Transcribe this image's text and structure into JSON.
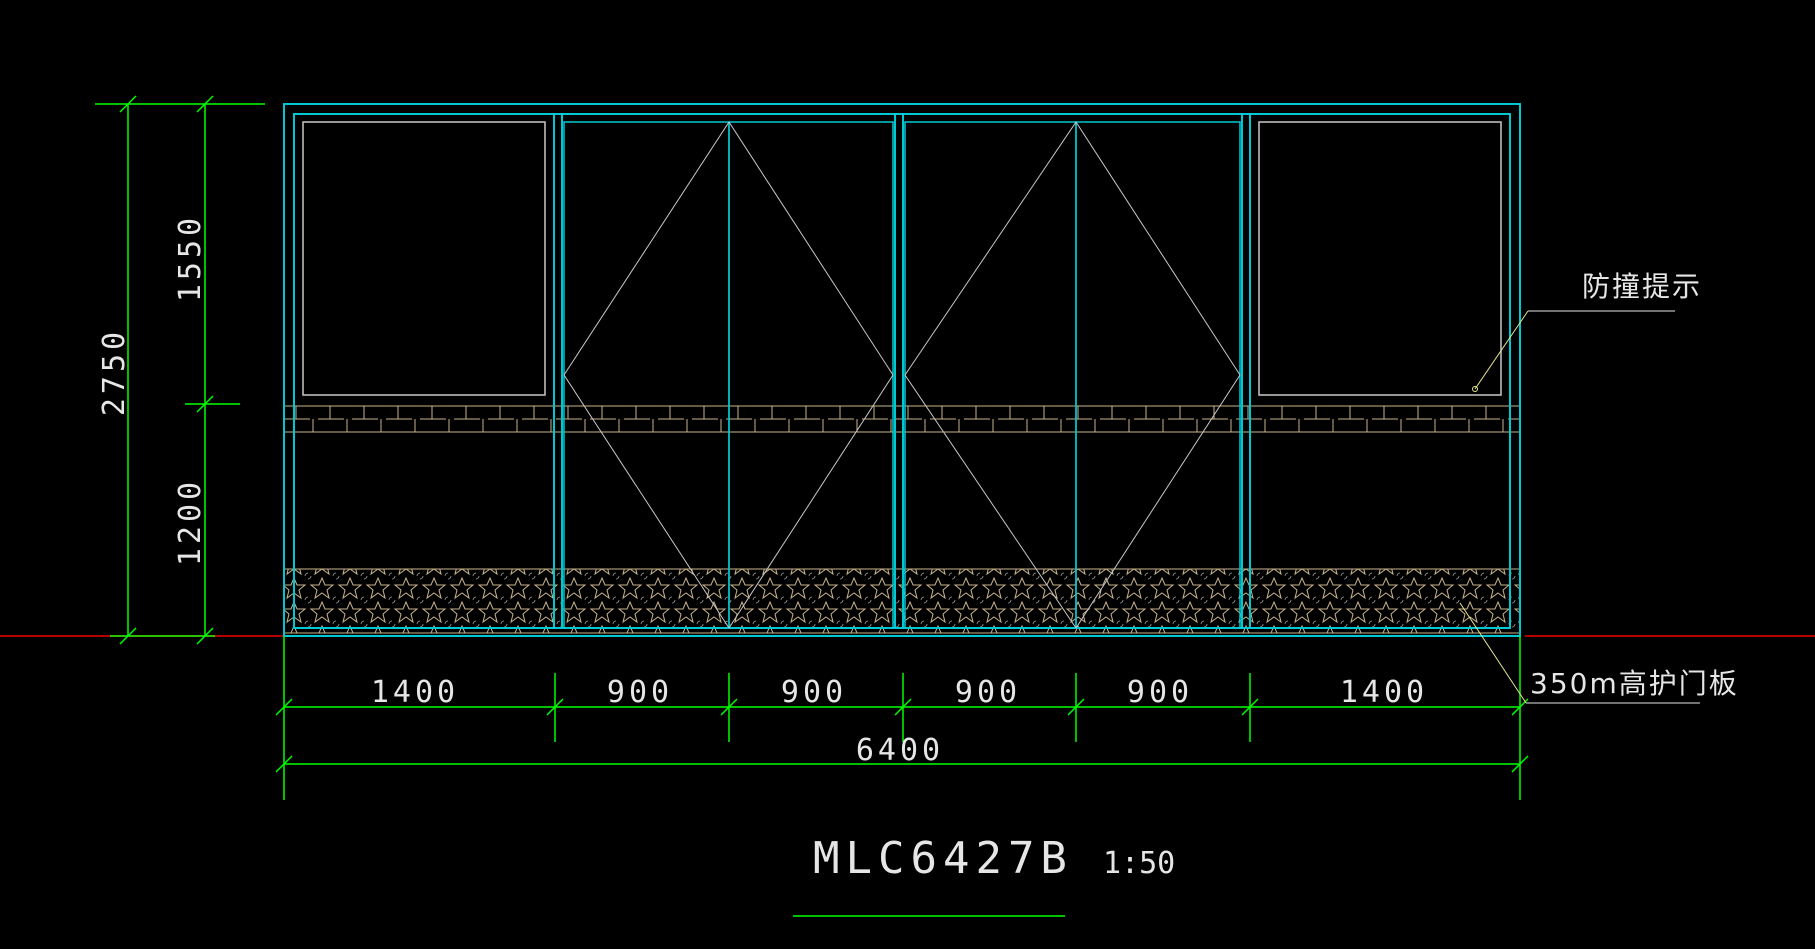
{
  "drawing": {
    "title": "MLC6427B",
    "scale": "1:50",
    "labels": {
      "anti_collision": "防撞提示",
      "guard_plate": "350m高护门板"
    },
    "dimensions": {
      "total_height": "2750",
      "upper_height": "1550",
      "lower_height": "1200",
      "total_width": "6400",
      "segments": [
        "1400",
        "900",
        "900",
        "900",
        "900",
        "1400"
      ]
    }
  },
  "colors": {
    "background": "#000000",
    "frame": "#00c8d2",
    "dimension": "#00ff00",
    "text": "#e6e6e6",
    "leader": "#e6e68c",
    "ground": "#b40000",
    "glass_line": "#c8c8c8",
    "pattern": "#c8b48c"
  }
}
